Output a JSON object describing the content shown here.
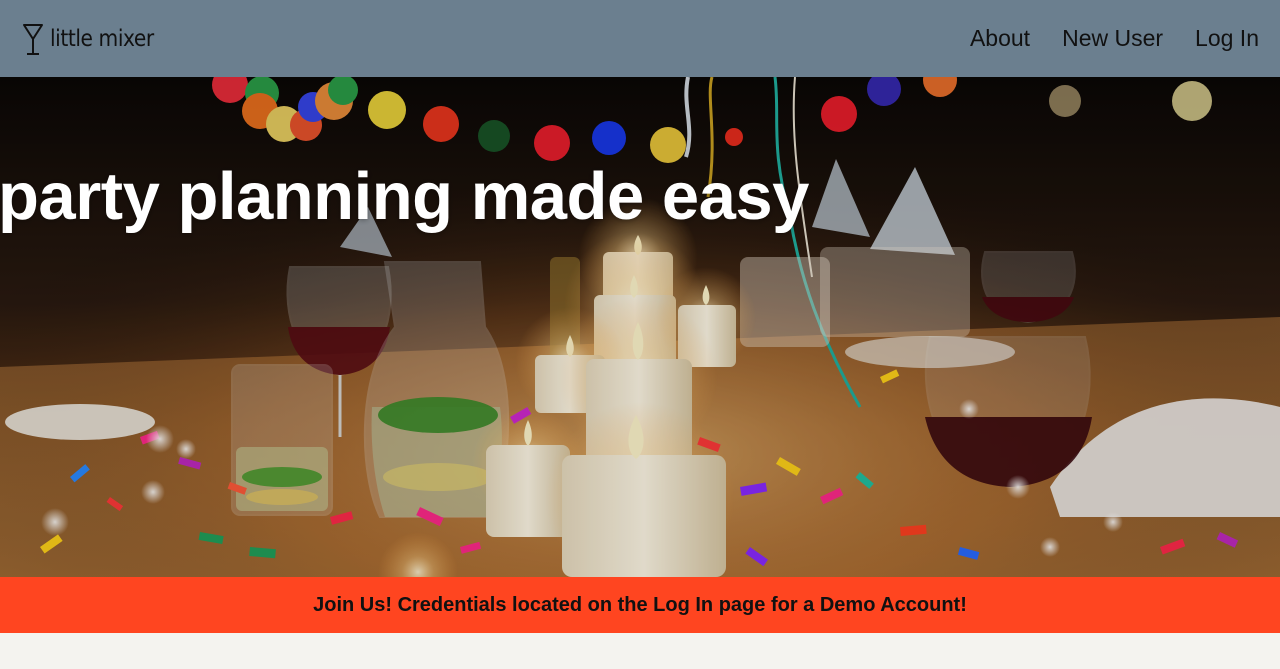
{
  "header": {
    "logo_text": "little mixer",
    "nav": [
      {
        "label": "About"
      },
      {
        "label": "New User"
      },
      {
        "label": "Log In"
      }
    ],
    "background_color": "#6b7f8f"
  },
  "hero": {
    "headline": "party planning made easy",
    "image_description_icon": "party-table-photo"
  },
  "banner": {
    "text": "Join Us! Credentials located on the Log In page for a Demo Account!",
    "background_color": "#ff4520"
  }
}
